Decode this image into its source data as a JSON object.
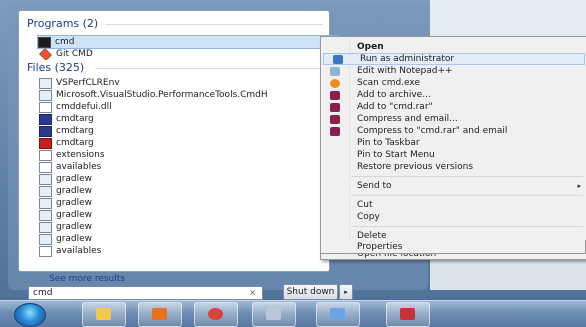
{
  "start_menu": {
    "programs_header": "Programs (2)",
    "programs": [
      {
        "label": "cmd",
        "icon": "cmd-icon",
        "selected": true
      },
      {
        "label": "Git CMD",
        "icon": "git-icon",
        "selected": false
      }
    ],
    "files_header": "Files (325)",
    "files": [
      {
        "label": "VSPerfCLREnv",
        "icon": "file-icon"
      },
      {
        "label": "Microsoft.VisualStudio.PerformanceTools.CmdH",
        "icon": "file-icon"
      },
      {
        "label": "cmddefui.dll",
        "icon": "dll-icon"
      },
      {
        "label": "cmdtarg",
        "icon": "exe-icon"
      },
      {
        "label": "cmdtarg",
        "icon": "exe-icon"
      },
      {
        "label": "cmdtarg",
        "icon": "archive-icon"
      },
      {
        "label": "extensions",
        "icon": "document-icon"
      },
      {
        "label": "availables",
        "icon": "document-icon"
      },
      {
        "label": "gradlew",
        "icon": "file-icon"
      },
      {
        "label": "gradlew",
        "icon": "file-icon"
      },
      {
        "label": "gradlew",
        "icon": "file-icon"
      },
      {
        "label": "gradlew",
        "icon": "file-icon"
      },
      {
        "label": "gradlew",
        "icon": "file-icon"
      },
      {
        "label": "gradlew",
        "icon": "file-icon"
      },
      {
        "label": "availables",
        "icon": "document-icon"
      }
    ],
    "see_more": "See more results",
    "search_value": "cmd",
    "search_clear": "×",
    "shutdown_label": "Shut down",
    "shutdown_arrow": "▸"
  },
  "context_menu": {
    "items": [
      {
        "label": "Open",
        "bold": true,
        "icon": ""
      },
      {
        "label": "Run as administrator",
        "icon": "shield-icon",
        "hover": true
      },
      {
        "label": "Edit with Notepad++",
        "icon": "notepad-icon"
      },
      {
        "label": "Scan cmd.exe",
        "icon": "scan-icon"
      },
      {
        "label": "Add to archive...",
        "icon": "archive-icon"
      },
      {
        "label": "Add to \"cmd.rar\"",
        "icon": "archive-icon"
      },
      {
        "label": "Compress and email...",
        "icon": "archive-icon"
      },
      {
        "label": "Compress to \"cmd.rar\" and email",
        "icon": "archive-icon"
      },
      {
        "label": "Pin to Taskbar",
        "icon": ""
      },
      {
        "label": "Pin to Start Menu",
        "icon": ""
      },
      {
        "label": "Restore previous versions",
        "icon": ""
      },
      {
        "label": "Send to",
        "icon": "",
        "submenu": true
      },
      {
        "label": "Cut",
        "icon": ""
      },
      {
        "label": "Copy",
        "icon": ""
      },
      {
        "label": "Delete",
        "icon": ""
      },
      {
        "label": "Open file location",
        "icon": ""
      },
      {
        "label": "Properties",
        "icon": ""
      }
    ],
    "submenu_arrow": "▸"
  },
  "taskbar": {
    "buttons": [
      "start-orb",
      "explorer-icon",
      "media-player-icon",
      "chrome-icon",
      "network-icon",
      "remote-icon",
      "paint-icon"
    ],
    "colors": {
      "accent": "#2a8ad6"
    }
  }
}
